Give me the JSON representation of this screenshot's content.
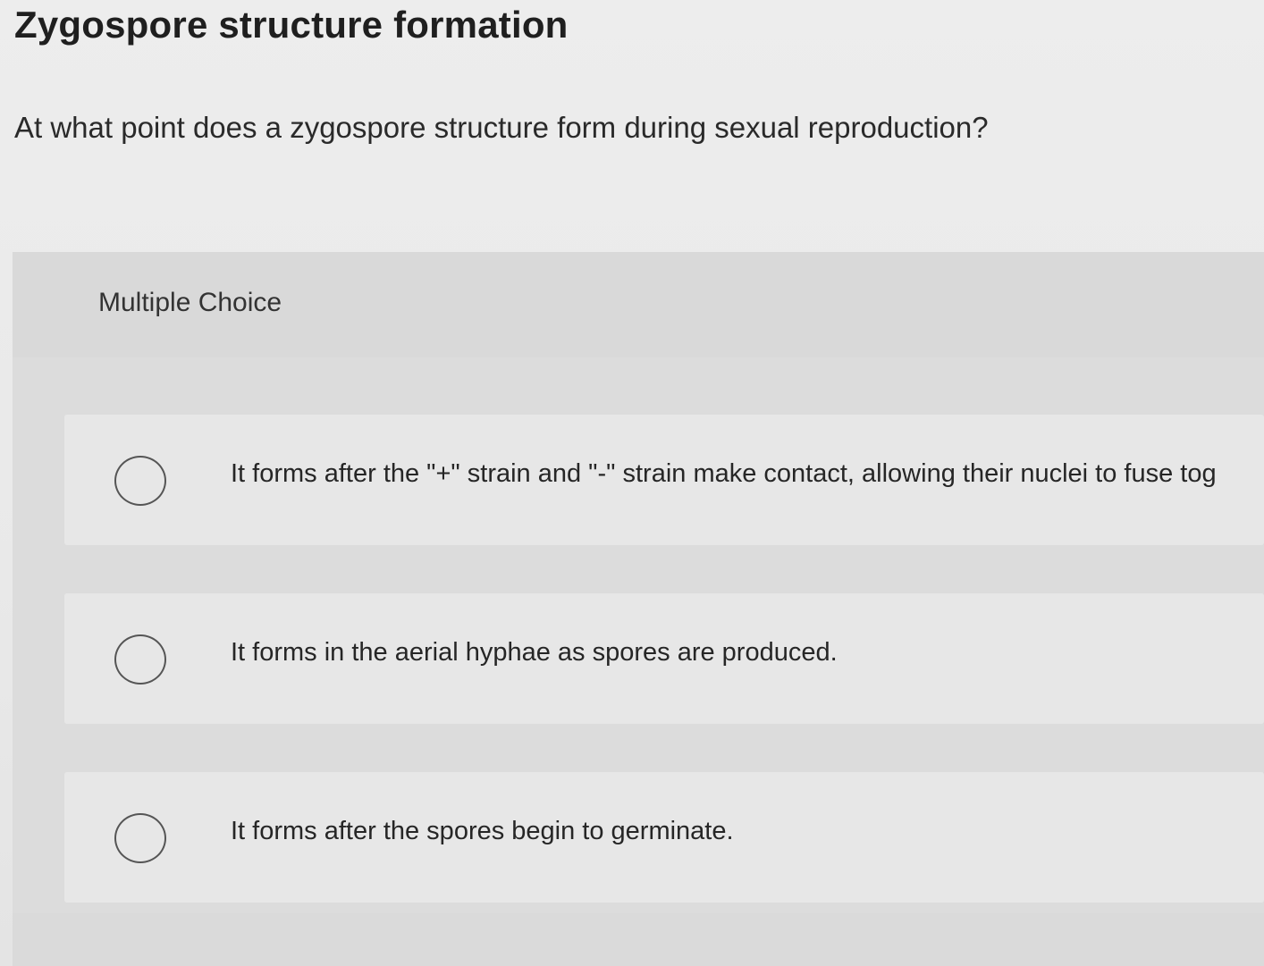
{
  "title": "Zygospore structure formation",
  "question": "At what point does a zygospore structure form during sexual reproduction?",
  "answer_panel": {
    "type_label": "Multiple Choice",
    "options": [
      {
        "text": "It forms after the \"+\" strain and \"-\" strain make contact, allowing their nuclei to fuse tog",
        "selected": false
      },
      {
        "text": "It forms in the aerial hyphae as spores are produced.",
        "selected": false
      },
      {
        "text": "It forms after the spores begin to germinate.",
        "selected": false
      }
    ]
  }
}
